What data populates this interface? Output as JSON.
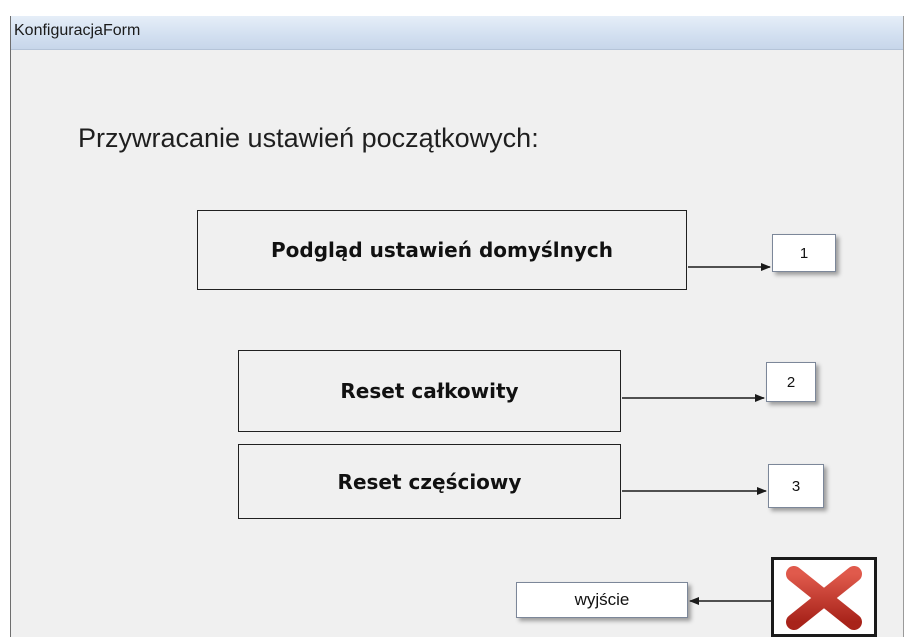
{
  "window": {
    "title": "KonfiguracjaForm"
  },
  "heading": "Przywracanie ustawień początkowych:",
  "buttons": {
    "preview": "Podgląd ustawień domyślnych",
    "reset_full": "Reset całkowity",
    "reset_partial": "Reset częściowy",
    "exit": "wyjście"
  },
  "callouts": [
    "1",
    "2",
    "3"
  ],
  "icons": {
    "close": "red-x-icon"
  },
  "colors": {
    "close_red": "#c0392b",
    "titlebar": "#d2dff0",
    "background": "#f0f0f0"
  }
}
